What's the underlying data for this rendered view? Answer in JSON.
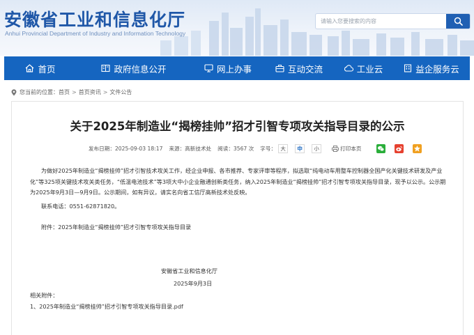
{
  "site": {
    "title_cn": "安徽省工业和信息化厅",
    "title_en": "Anhui Provincial Department of Industry and Information Technology"
  },
  "search": {
    "placeholder": "请输入您要搜索的内容",
    "icon": "search-icon"
  },
  "nav": {
    "items": [
      {
        "label": "首页",
        "icon": "home-icon"
      },
      {
        "label": "政府信息公开",
        "icon": "book-icon"
      },
      {
        "label": "网上办事",
        "icon": "monitor-icon"
      },
      {
        "label": "互动交流",
        "icon": "briefcase-icon"
      },
      {
        "label": "工业云",
        "icon": "cloud-icon"
      },
      {
        "label": "益企服务云",
        "icon": "building-icon"
      }
    ]
  },
  "breadcrumb": {
    "prefix": "您当前的位置：",
    "items": [
      "首页",
      "首页资讯",
      "文件公告"
    ],
    "separator": ">"
  },
  "article": {
    "title": "关于2025年制造业“揭榜挂帅”招才引智专项攻关指导目录的公示",
    "meta": {
      "publish_date": "发布日期：2025-09-03 18:17",
      "source": "来源：高新技术处",
      "views": "阅读：3567 次",
      "font_size_label": "字号：",
      "font_sizes": [
        "大",
        "中",
        "小"
      ],
      "print_label": "打印本页"
    },
    "body": "为做好2025年制造业“揭榜挂帅”招才引智技术攻关工作，经企业申报、各市推荐、专家评审等程序，拟选取“纯电动车用整车控制器全国产化关键技术研发及产业化”等325项关键技术攻关类任务，“低温电池技术”等3项大中小企业融通创新类任务，纳入2025年制造业“揭榜挂帅”招才引智专项攻关指导目录，现予以公示。公示期为2025年9月3日—9月9日。公示期间，如有异议，请实名向省工信厅高新技术处反映。",
    "contact": "联系电话：0551-62871820。",
    "attachment_note": "附件：2025年制造业“揭榜挂帅”招才引智专项攻关指导目录",
    "signature_org": "安徽省工业和信息化厅",
    "signature_date": "2025年9月3日",
    "related_label": "相关附件：",
    "related_file": "1、2025年制造业“揭榜挂帅”招才引智专项攻关指导目录.pdf"
  },
  "colors": {
    "nav_bg": "#1565c0",
    "brand_text": "#1f57a8",
    "search_button": "#1f5fb3",
    "wechat": "#2aae3a",
    "weibo": "#e6412f",
    "favorite": "#f0a020"
  }
}
